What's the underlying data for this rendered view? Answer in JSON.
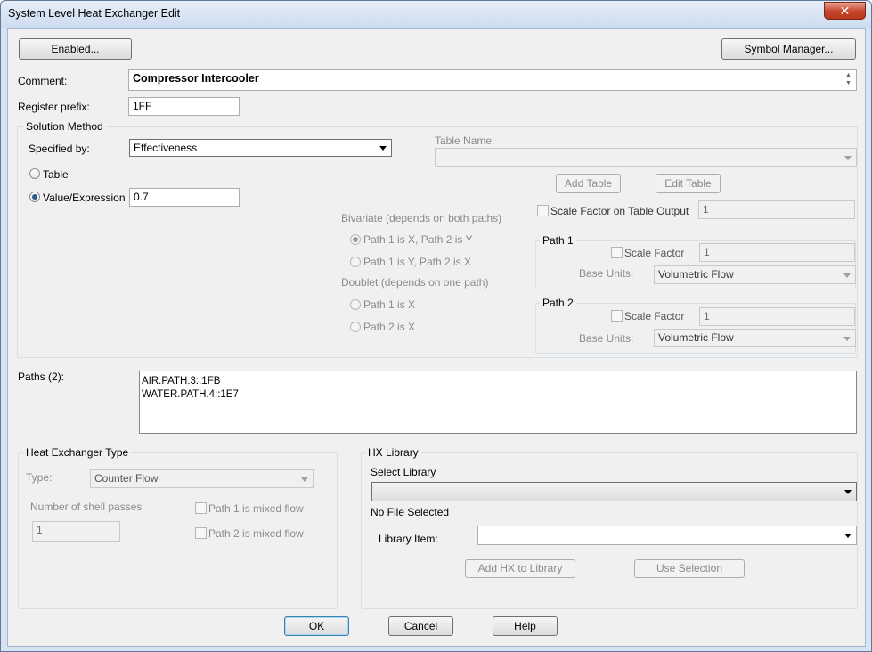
{
  "window": {
    "title": "System Level Heat Exchanger Edit",
    "close_glyph": "✕"
  },
  "top": {
    "enabled_btn": "Enabled...",
    "symbol_btn": "Symbol Manager..."
  },
  "comment": {
    "label": "Comment:",
    "value": "Compressor Intercooler"
  },
  "register": {
    "label": "Register prefix:",
    "value": "1FF"
  },
  "solution": {
    "title": "Solution Method",
    "specified_label": "Specified by:",
    "specified_value": "Effectiveness",
    "table_radio": "Table",
    "value_radio": "Value/Expression",
    "value_input": "0.7",
    "table_name_label": "Table Name:",
    "add_table": "Add Table",
    "edit_table": "Edit Table",
    "scale_output_label": "Scale Factor on Table Output",
    "scale_output_value": "1",
    "bivariate_label": "Bivariate (depends on both paths)",
    "bi_opt1": "Path 1 is X, Path 2 is Y",
    "bi_opt2": "Path 1 is Y, Path 2 is X",
    "doublet_label": "Doublet (depends on one path)",
    "dbl_opt1": "Path 1 is X",
    "dbl_opt2": "Path 2 is X",
    "path1": {
      "title": "Path 1",
      "scale_label": "Scale Factor",
      "scale_value": "1",
      "base_label": "Base Units:",
      "base_value": "Volumetric Flow"
    },
    "path2": {
      "title": "Path 2",
      "scale_label": "Scale Factor",
      "scale_value": "1",
      "base_label": "Base Units:",
      "base_value": "Volumetric Flow"
    }
  },
  "paths": {
    "label": "Paths (2):",
    "items": [
      "AIR.PATH.3::1FB",
      "WATER.PATH.4::1E7"
    ]
  },
  "hx_type": {
    "title": "Heat Exchanger Type",
    "type_label": "Type:",
    "type_value": "Counter Flow",
    "shell_label": "Number of shell passes",
    "shell_value": "1",
    "mixed1": "Path 1 is mixed flow",
    "mixed2": "Path 2 is mixed flow"
  },
  "hx_library": {
    "title": "HX Library",
    "select_label": "Select Library",
    "no_file": "No File Selected",
    "item_label": "Library Item:",
    "add_btn": "Add HX to Library",
    "use_btn": "Use Selection"
  },
  "footer": {
    "ok": "OK",
    "cancel": "Cancel",
    "help": "Help"
  }
}
